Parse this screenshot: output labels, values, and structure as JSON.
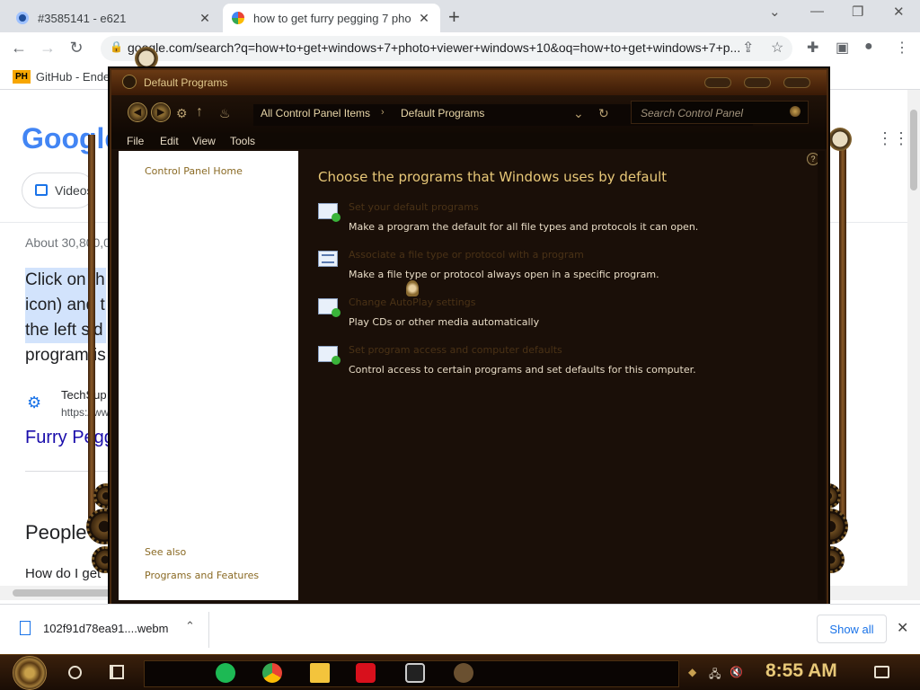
{
  "browser": {
    "tabs": [
      {
        "title": "#3585141 - e621"
      },
      {
        "title": "how to get furry pegging 7 pho"
      }
    ],
    "address": "google.com/search?q=how+to+get+windows+7+photo+viewer+windows+10&oq=how+to+get+windows+7+p...",
    "bookmark": "GitHub - Ender"
  },
  "google": {
    "logo": "Google",
    "chip_videos": "Videos",
    "about": "About 30,800,0",
    "snippet_lines": [
      "Click on th",
      "icon) and t",
      "the left sid",
      "program is"
    ],
    "source_name": "TechSup",
    "source_url": "https://ww",
    "result_link": "Furry Pegg",
    "people_heading": "People a",
    "people_q": "How do I get"
  },
  "downloads": {
    "file": "102f91d78ea91....webm",
    "show_all": "Show all"
  },
  "cp": {
    "title": "Default Programs",
    "crumbs": [
      "All Control Panel Items",
      "Default Programs"
    ],
    "search_placeholder": "Search Control Panel",
    "menu": [
      "File",
      "Edit",
      "View",
      "Tools"
    ],
    "left_links": {
      "home": "Control Panel Home",
      "see_also": "See also",
      "programs_features": "Programs and Features"
    },
    "heading": "Choose the programs that Windows uses by default",
    "tasks": [
      {
        "title": "Set your default programs",
        "desc": "Make a program the default for all file types and protocols it can open."
      },
      {
        "title": "Associate a file type or protocol with a program",
        "desc": "Make a file type or protocol always open in a specific program."
      },
      {
        "title": "Change AutoPlay settings",
        "desc": "Play CDs or other media automatically"
      },
      {
        "title": "Set program access and computer defaults",
        "desc": "Control access to certain programs and set defaults for this computer."
      }
    ]
  },
  "taskbar": {
    "clock": "8:55 AM"
  },
  "colors": {
    "accent_gold": "#e8c878",
    "window_bg": "#1a0f08",
    "link_brown": "#8a6a24",
    "google_blue": "#1a0dab"
  },
  "icons": [
    "circle-tab-icon",
    "google-tab-icon",
    "back-icon",
    "forward-icon",
    "reload-icon",
    "lock-icon",
    "share-icon",
    "star-icon",
    "extensions-icon",
    "sidepanel-icon",
    "profile-icon",
    "menu-icon",
    "apps-grid-icon",
    "search-icon",
    "help-icon",
    "spotify-icon",
    "chrome-icon",
    "file-explorer-icon",
    "flash-icon",
    "photos-icon",
    "network-icon",
    "volume-muted-icon",
    "notification-icon"
  ]
}
